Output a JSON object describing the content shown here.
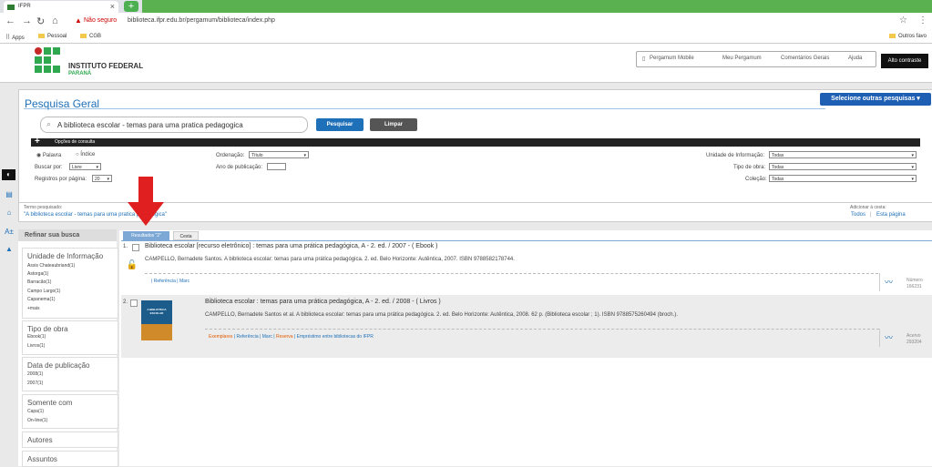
{
  "browser": {
    "tab_title": "IFPR",
    "tab_close": "×",
    "new_tab": "+",
    "not_secure": "Não seguro",
    "url": "biblioteca.ifpr.edu.br/pergamum/biblioteca/index.php",
    "bookmarks": [
      "Apps",
      "Pessoal",
      "CGB"
    ],
    "other_bookmarks": "Outros favo"
  },
  "site": {
    "brand_name": "INSTITUTO FEDERAL",
    "brand_sub": "PARANÁ",
    "top_links": [
      "Pergamum Mobile",
      "Meu Pergamum",
      "Comentários Gerais",
      "Ajuda"
    ],
    "contrast_btn": "Alto contraste"
  },
  "search": {
    "title": "Pesquisa Geral",
    "other_searches": "Selecione outras pesquisas",
    "query": "A biblioteca escolar - temas para uma pratica pedagogica",
    "btn_search": "Pesquisar",
    "btn_clear": "Limpar",
    "options_label": "Opções de consulta",
    "radio_palavra": "Palavra",
    "radio_indice": "Índice",
    "buscar_por_label": "Buscar por:",
    "buscar_por_value": "Livre",
    "registros_label": "Registros por página:",
    "registros_value": "20",
    "ordenacao_label": "Ordenação:",
    "ordenacao_value": "Título",
    "ano_label": "Ano de publicação:",
    "unidade_label": "Unidade de Informação:",
    "unidade_value": "Todas",
    "tipo_label": "Tipo de obra:",
    "tipo_value": "Todas",
    "colecao_label": "Coleção:",
    "colecao_value": "Todas"
  },
  "termo": {
    "label": "Termo pesquisado:",
    "value": "\"A biblioteca escolar - temas para uma pratica pedagogica\"",
    "add_label": "Adicionar à cesta:",
    "add_todos": "Todos",
    "add_pagina": "Esta página"
  },
  "facets": {
    "header": "Refinar sua busca",
    "groups": [
      {
        "title": "Unidade de Informação",
        "items": [
          "Assis Chateaubriand(1)",
          "Astorga(1)",
          "Barracão(1)",
          "Campo Largo(1)",
          "Capanema(1)",
          "+mais"
        ]
      },
      {
        "title": "Tipo de obra",
        "items": [
          "Ebook(1)",
          "Livros(1)"
        ]
      },
      {
        "title": "Data de publicação",
        "items": [
          "2008(1)",
          "2007(1)"
        ]
      },
      {
        "title": "Somente com",
        "items": [
          "Capa(1)",
          "On-line(1)"
        ]
      },
      {
        "title": "Autores",
        "items": []
      },
      {
        "title": "Assuntos",
        "items": []
      }
    ]
  },
  "results": {
    "tab_results": "Resultados \"2\"",
    "tab_cesta": "Cesta",
    "items": [
      {
        "num": "1.",
        "title": "Biblioteca escolar [recurso eletrônico] : temas para uma prática pedagógica, A - 2. ed. / 2007 - ( Ebook )",
        "desc": "CAMPELLO, Bernadete Santos. A biblioteca escolar: temas para uma prática pedagógica. 2. ed. Belo Horizonte: Autêntica, 2007. ISBN 9788582178744.",
        "links": [
          "Referência",
          "Marc"
        ],
        "acq_label": "Número",
        "acq_num": "166231"
      },
      {
        "num": "2.",
        "title": "Biblioteca escolar : temas para uma prática pedagógica, A - 2. ed. / 2008 - ( Livros )",
        "desc": "CAMPELLO, Bernadete Santos et al. A biblioteca escolar: temas para uma prática pedagógica. 2. ed. Belo Horizonte: Autêntica, 2008. 62 p. (Biblioteca escolar ; 1). ISBN 9788575260494 (broch.).",
        "links": [
          "Exemplares",
          "Referência",
          "Marc",
          "Reserva",
          "Empréstimo entre bibliotecas do IFPR"
        ],
        "cover_title": "A BIBLIOTECA ESCOLAR",
        "acq_label": "Acervo",
        "acq_num": "293204"
      }
    ]
  },
  "colors": {
    "accent": "#1e70b8",
    "brand_green": "#2fa84f",
    "arrow": "#e02020"
  }
}
